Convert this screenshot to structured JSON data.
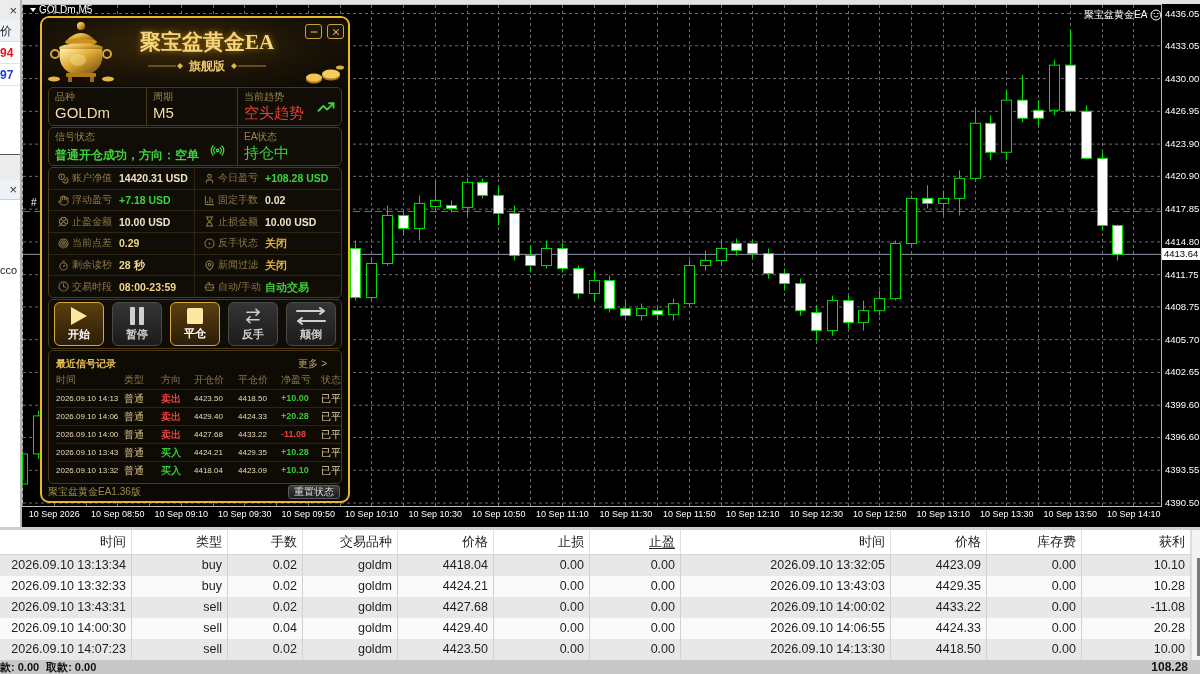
{
  "market_watch": {
    "close": "×",
    "column_header": "价",
    "prices": [
      {
        "text": "94",
        "color": "#e4161c"
      },
      {
        "text": "97",
        "color": "#1f3bdc"
      }
    ]
  },
  "navigator": {
    "close": "×",
    "item": "cco"
  },
  "chart": {
    "ea_label": "聚宝盆黄金EA",
    "marker": "#",
    "chart_data": {
      "type": "candlestick",
      "title": "GOLDm,M5",
      "grid": true,
      "categories": [
        null,
        null,
        "10 Sep 2026",
        null,
        null,
        null,
        "10 Sep 08:50",
        null,
        null,
        null,
        "10 Sep 09:10",
        null,
        null,
        null,
        "10 Sep 09:30",
        null,
        null,
        null,
        "10 Sep 09:50",
        null,
        null,
        null,
        "10 Sep 10:10",
        null,
        null,
        null,
        "10 Sep 10:30",
        null,
        null,
        null,
        "10 Sep 10:50",
        null,
        null,
        null,
        "10 Sep 11:10",
        null,
        null,
        null,
        "10 Sep 11:30",
        null,
        null,
        null,
        "10 Sep 11:50",
        null,
        null,
        null,
        "10 Sep 12:10",
        null,
        null,
        null,
        "10 Sep 12:30",
        null,
        null,
        null,
        "10 Sep 12:50",
        null,
        null,
        null,
        "10 Sep 13:10",
        null,
        null,
        null,
        "10 Sep 13:30",
        null,
        null,
        null,
        "10 Sep 13:50",
        null,
        null,
        null,
        "10 Sep 14:10"
      ],
      "ohlc": [
        [
          4392.27,
          4395.07,
          4392.27,
          4395.07
        ],
        [
          4395.07,
          4399.08,
          4394.61,
          4398.61
        ],
        null,
        null,
        null,
        null,
        null,
        null,
        null,
        null,
        null,
        null,
        null,
        null,
        null,
        null,
        null,
        null,
        null,
        null,
        null,
        [
          4414.19,
          4414.93,
          4409.34,
          4409.62
        ],
        [
          4409.62,
          4413.25,
          4409.34,
          4412.79
        ],
        [
          4412.79,
          4418.19,
          4412.6,
          4417.26
        ],
        [
          4417.26,
          4417.73,
          4415.4,
          4416.05
        ],
        [
          4416.05,
          4419.13,
          4414.93,
          4418.38
        ],
        [
          4418.1,
          4420.53,
          4417.54,
          4418.66
        ],
        [
          4418.19,
          4418.66,
          4417.54,
          4417.91
        ],
        [
          4418.01,
          4420.71,
          4417.26,
          4420.34
        ],
        [
          4420.34,
          4420.71,
          4418.85,
          4419.13
        ],
        [
          4419.13,
          4420.06,
          4416.33,
          4417.45
        ],
        [
          4417.45,
          4418.19,
          4413.07,
          4413.53
        ],
        [
          4413.53,
          4414.46,
          4411.95,
          4412.6
        ],
        [
          4412.6,
          4414.93,
          4412.32,
          4414.19
        ],
        [
          4414.19,
          4414.74,
          4411.95,
          4412.32
        ],
        [
          4412.32,
          4412.6,
          4409.52,
          4409.99
        ],
        [
          4409.99,
          4412.13,
          4409.34,
          4411.2
        ],
        [
          4411.2,
          4411.67,
          4408.22,
          4408.59
        ],
        [
          4408.59,
          4409.34,
          4407.47,
          4407.94
        ],
        [
          4407.94,
          4409.06,
          4407.47,
          4408.59
        ],
        [
          4408.4,
          4408.87,
          4407.66,
          4408.03
        ],
        [
          4408.03,
          4409.52,
          4407.47,
          4409.06
        ],
        [
          4409.06,
          4413.07,
          4408.87,
          4412.6
        ],
        [
          4412.6,
          4414.0,
          4412.13,
          4413.07
        ],
        [
          4413.07,
          4414.93,
          4412.6,
          4414.19
        ],
        [
          4414.65,
          4415.12,
          4413.53,
          4414.0
        ],
        [
          4414.65,
          4414.93,
          4413.35,
          4413.72
        ],
        [
          4413.72,
          4414.19,
          4411.39,
          4411.85
        ],
        [
          4411.85,
          4412.32,
          4410.27,
          4410.92
        ],
        [
          4410.92,
          4411.39,
          4407.94,
          4408.4
        ],
        [
          4408.22,
          4408.87,
          4405.61,
          4406.54
        ],
        [
          4406.54,
          4409.8,
          4406.07,
          4409.34
        ],
        [
          4409.34,
          4409.8,
          4406.73,
          4407.29
        ],
        [
          4407.29,
          4409.34,
          4406.54,
          4408.4
        ],
        [
          4408.4,
          4410.27,
          4407.94,
          4409.52
        ],
        [
          4409.52,
          4414.93,
          4409.34,
          4414.65
        ],
        [
          4414.65,
          4419.13,
          4414.46,
          4418.85
        ],
        [
          4418.85,
          4420.06,
          4417.91,
          4418.38
        ],
        [
          4418.38,
          4419.59,
          4417.26,
          4418.85
        ],
        [
          4418.85,
          4421.46,
          4417.26,
          4420.71
        ],
        [
          4420.71,
          4427.05,
          4420.53,
          4425.84
        ],
        [
          4425.84,
          4426.59,
          4422.39,
          4423.14
        ],
        [
          4423.14,
          4428.92,
          4422.39,
          4427.99
        ],
        [
          4427.99,
          4430.32,
          4425.93,
          4426.31
        ],
        [
          4427.05,
          4427.99,
          4425.65,
          4426.31
        ],
        [
          4427.05,
          4431.71,
          4426.59,
          4431.25
        ],
        [
          4431.25,
          4434.51,
          4426.87,
          4426.96
        ],
        [
          4426.96,
          4427.52,
          4422.48,
          4422.58
        ],
        [
          4422.58,
          4423.14,
          4415.86,
          4416.33
        ],
        [
          4416.33,
          4416.42,
          4413.07,
          4413.64
        ],
        null
      ],
      "ylim": [
        4390.13,
        4436.94
      ],
      "yticks": [
        {
          "value": 4436.05,
          "label": "4436.05"
        },
        {
          "value": 4433.05,
          "label": "4433.05"
        },
        {
          "value": 4430.0,
          "label": "4430.00"
        },
        {
          "value": 4426.95,
          "label": "4426.95"
        },
        {
          "value": 4423.9,
          "label": "4423.90"
        },
        {
          "value": 4420.9,
          "label": "4420.90"
        },
        {
          "value": 4417.85,
          "label": "4417.85"
        },
        {
          "value": 4414.8,
          "label": "4414.80"
        },
        {
          "value": 4411.75,
          "label": "4411.75"
        },
        {
          "value": 4408.75,
          "label": "4408.75"
        },
        {
          "value": 4405.7,
          "label": "4405.70"
        },
        {
          "value": 4402.65,
          "label": "4402.65"
        },
        {
          "value": 4399.6,
          "label": "4399.60"
        },
        {
          "value": 4396.6,
          "label": "4396.60"
        },
        {
          "value": 4393.55,
          "label": "4393.55"
        },
        {
          "value": 4390.5,
          "label": "4390.50"
        }
      ],
      "ref_lines": [
        {
          "axis": "y",
          "value": 4417.63,
          "color": "#00b800"
        },
        {
          "axis": "y",
          "value": 4413.64,
          "color": "#8a96a6",
          "label": "4413.64"
        }
      ]
    }
  },
  "ea_panel": {
    "title": "聚宝盆黄金EA",
    "subtitle": "旗舰版",
    "market": [
      {
        "label": "品种",
        "value": "GOLDm",
        "color": "#f3dcaa",
        "kind": "plain"
      },
      {
        "label": "周期",
        "value": "M5",
        "color": "#f3dcaa",
        "kind": "plain"
      },
      {
        "label": "当前趋势",
        "value": "空头趋势",
        "color": "#e8403a",
        "kind": "trend"
      }
    ],
    "status": [
      {
        "label": "信号状态",
        "value": "普通开仓成功，方向：空单",
        "color": "#3ed33e",
        "kind": "signal"
      },
      {
        "label": "EA状态",
        "value": "持仓中",
        "color": "#3ed33e",
        "kind": "plain"
      }
    ],
    "stats": [
      {
        "label": "账户净值",
        "value": "14420.31 USD",
        "color": "#efe3c4"
      },
      {
        "label": "今日盈亏",
        "value": "+108.28 USD",
        "color": "#3ed33e"
      },
      {
        "label": "浮动盈亏",
        "value": "+7.18 USD",
        "color": "#3ed33e"
      },
      {
        "label": "固定手数",
        "value": "0.02",
        "color": "#efe3c4"
      },
      {
        "label": "止盈金额",
        "value": "10.00 USD",
        "color": "#efe3c4"
      },
      {
        "label": "止损金额",
        "value": "10.00 USD",
        "color": "#efe3c4"
      },
      {
        "label": "当前点差",
        "value": "0.29",
        "color": "#f0d48a"
      },
      {
        "label": "反手状态",
        "value": "关闭",
        "color": "#e6b440"
      },
      {
        "label": "剩余读秒",
        "value": "28 秒",
        "color": "#f0d48a"
      },
      {
        "label": "新闻过滤",
        "value": "关闭",
        "color": "#e6b440"
      },
      {
        "label": "交易时段",
        "value": "08:00-23:59",
        "color": "#f0d48a"
      },
      {
        "label": "自动/手动",
        "value": "自动交易",
        "color": "#3ed33e"
      }
    ],
    "buttons": [
      {
        "label": "开始",
        "active": true
      },
      {
        "label": "暂停",
        "active": false
      },
      {
        "label": "平仓",
        "active": true
      },
      {
        "label": "反手",
        "active": false
      },
      {
        "label": "颠倒",
        "active": false
      }
    ],
    "records": {
      "title": "最近信号记录",
      "more": "更多 >",
      "columns": [
        "时间",
        "类型",
        "方向",
        "开仓价",
        "平仓价",
        "净盈亏",
        "状态"
      ],
      "rows": [
        {
          "time": "2026.09.10 14:13",
          "type": "普通",
          "direction": {
            "text": "卖出",
            "color": "#e8423a"
          },
          "open": "4423.50",
          "close": "4418.50",
          "profit": {
            "text": "+10.00",
            "color": "#35c735"
          },
          "status": "已平"
        },
        {
          "time": "2026.09.10 14:06",
          "type": "普通",
          "direction": {
            "text": "卖出",
            "color": "#e8423a"
          },
          "open": "4429.40",
          "close": "4424.33",
          "profit": {
            "text": "+20.28",
            "color": "#35c735"
          },
          "status": "已平"
        },
        {
          "time": "2026.09.10 14:00",
          "type": "普通",
          "direction": {
            "text": "卖出",
            "color": "#e8423a"
          },
          "open": "4427.68",
          "close": "4433.22",
          "profit": {
            "text": "-11.08",
            "color": "#e8423a"
          },
          "status": "已平"
        },
        {
          "time": "2026.09.10 13:43",
          "type": "普通",
          "direction": {
            "text": "买入",
            "color": "#35c735"
          },
          "open": "4424.21",
          "close": "4429.35",
          "profit": {
            "text": "+10.28",
            "color": "#35c735"
          },
          "status": "已平"
        },
        {
          "time": "2026.09.10 13:32",
          "type": "普通",
          "direction": {
            "text": "买入",
            "color": "#35c735"
          },
          "open": "4418.04",
          "close": "4423.09",
          "profit": {
            "text": "+10.10",
            "color": "#35c735"
          },
          "status": "已平"
        }
      ]
    },
    "footer": {
      "version": "聚宝盆黄金EA1.36版",
      "reset_button": "重置状态"
    }
  },
  "trade_table": {
    "columns": [
      {
        "label": "时间",
        "sorted": false
      },
      {
        "label": "类型",
        "sorted": false
      },
      {
        "label": "手数",
        "sorted": false
      },
      {
        "label": "交易品种",
        "sorted": false
      },
      {
        "label": "价格",
        "sorted": false
      },
      {
        "label": "止损",
        "sorted": false
      },
      {
        "label": "止盈",
        "sorted": true
      },
      {
        "label": "时间",
        "sorted": false
      },
      {
        "label": "价格",
        "sorted": false
      },
      {
        "label": "库存费",
        "sorted": false
      },
      {
        "label": "获利",
        "sorted": false
      }
    ],
    "rows": [
      [
        "2026.09.10 13:13:34",
        "buy",
        "0.02",
        "goldm",
        "4418.04",
        "0.00",
        "0.00",
        "2026.09.10 13:32:05",
        "4423.09",
        "0.00",
        "10.10"
      ],
      [
        "2026.09.10 13:32:33",
        "buy",
        "0.02",
        "goldm",
        "4424.21",
        "0.00",
        "0.00",
        "2026.09.10 13:43:03",
        "4429.35",
        "0.00",
        "10.28"
      ],
      [
        "2026.09.10 13:43:31",
        "sell",
        "0.02",
        "goldm",
        "4427.68",
        "0.00",
        "0.00",
        "2026.09.10 14:00:02",
        "4433.22",
        "0.00",
        "-11.08"
      ],
      [
        "2026.09.10 14:00:30",
        "sell",
        "0.04",
        "goldm",
        "4429.40",
        "0.00",
        "0.00",
        "2026.09.10 14:06:55",
        "4424.33",
        "0.00",
        "20.28"
      ],
      [
        "2026.09.10 14:07:23",
        "sell",
        "0.02",
        "goldm",
        "4423.50",
        "0.00",
        "0.00",
        "2026.09.10 14:13:30",
        "4418.50",
        "0.00",
        "10.00"
      ]
    ],
    "footer": {
      "deposit": "款: 0.00",
      "withdrawal": "取款: 0.00",
      "total": "108.28"
    }
  }
}
